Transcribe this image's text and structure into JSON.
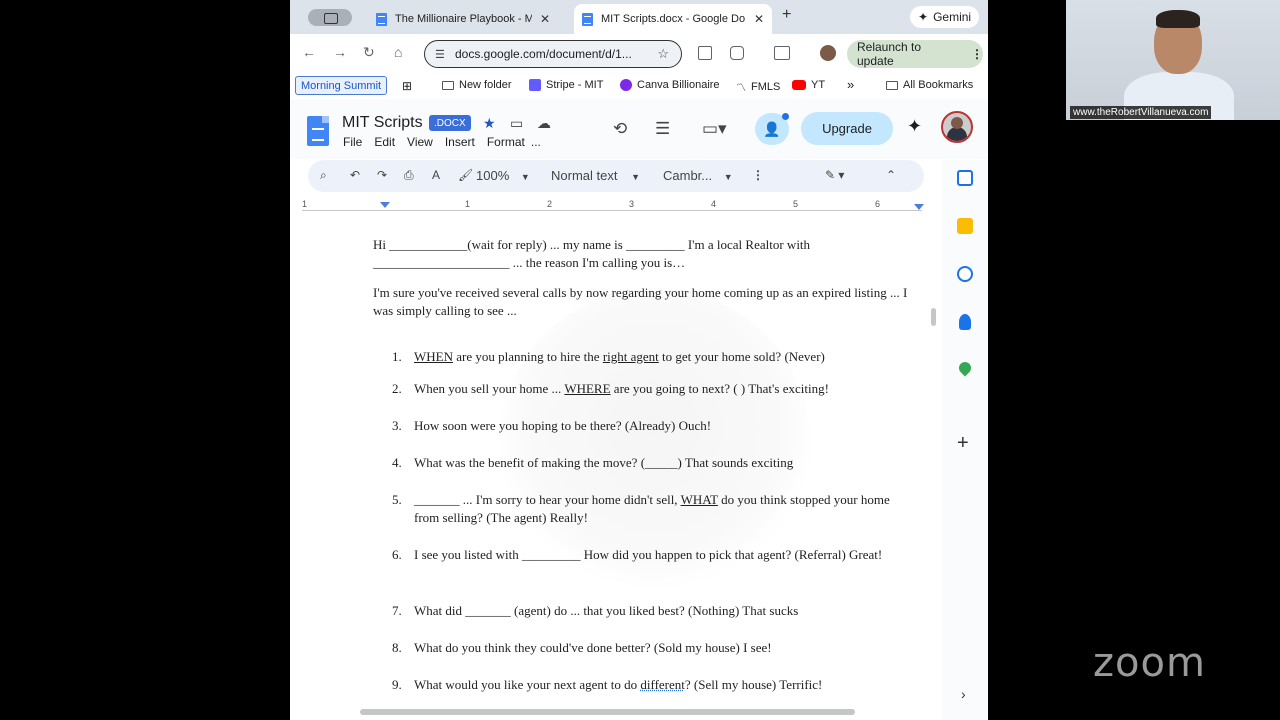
{
  "browser": {
    "tabs": [
      {
        "title": "The Millionaire Playbook - Ma",
        "active": false
      },
      {
        "title": "MIT Scripts.docx - Google Do",
        "active": true
      }
    ],
    "gemini_label": "Gemini",
    "url": "docs.google.com/document/d/1...",
    "relaunch_label": "Relaunch to update",
    "bookmarks": {
      "pinned": "Morning Summit",
      "items": [
        "New folder",
        "Stripe - MIT",
        "Canva Billionaire",
        "FMLS",
        "YT"
      ],
      "overflow": "»",
      "all": "All Bookmarks"
    }
  },
  "doc": {
    "title": "MIT Scripts",
    "badge": ".DOCX",
    "menu": [
      "File",
      "Edit",
      "View",
      "Insert",
      "Format",
      "..."
    ],
    "upgrade_label": "Upgrade",
    "toolbar": {
      "zoom": "100%",
      "style": "Normal text",
      "font": "Cambr..."
    },
    "ruler_numbers": [
      "1",
      "1",
      "2",
      "3",
      "4",
      "5",
      "6"
    ],
    "intro1": "Hi ____________(wait for reply) ... my name is _________ I'm a local Realtor with _____________________ ... the reason I'm calling you is…",
    "intro2": "I'm sure you've received several calls by now regarding your home coming up as an expired listing ... I was simply calling to see ...",
    "items": [
      {
        "num": "1.",
        "pre": "",
        "u1": "WHEN",
        "mid": " are you planning to hire the ",
        "u2": "right agent",
        "post": " to get your home sold? (Never)"
      },
      {
        "num": "2.",
        "pre": "When you sell your home ... ",
        "u1": "WHERE",
        "mid": " are you going to next? (     ) That's exciting!",
        "u2": "",
        "post": ""
      },
      {
        "num": "3.",
        "pre": "How soon were you hoping to be there? (Already) Ouch!",
        "u1": "",
        "mid": "",
        "u2": "",
        "post": ""
      },
      {
        "num": "4.",
        "pre": "What was the benefit of making the move? (_____) That sounds exciting",
        "u1": "",
        "mid": "",
        "u2": "",
        "post": ""
      },
      {
        "num": "5.",
        "pre": "_______ ... I'm sorry to hear your home didn't sell, ",
        "u1": "WHAT",
        "mid": " do you think stopped your home from selling? (The agent) Really!",
        "u2": "",
        "post": ""
      },
      {
        "num": "6.",
        "pre": "I see you listed with _________ How did you happen to pick that agent? (Referral) Great!",
        "u1": "",
        "mid": "",
        "u2": "",
        "post": ""
      },
      {
        "num": "7.",
        "pre": "What did  _______ (agent) do ... that you liked best? (Nothing) That sucks",
        "u1": "",
        "mid": "",
        "u2": "",
        "post": ""
      },
      {
        "num": "8.",
        "pre": "What do you think they could've done better? (Sold my house) I see!",
        "u1": "",
        "mid": "",
        "u2": "",
        "post": ""
      },
      {
        "num": "9.",
        "pre": "What would you like your next agent to do ",
        "u1": "different",
        "mid": "? (Sell my house) Terrific!",
        "u2": "",
        "post": ""
      }
    ]
  },
  "webcam": {
    "label": "www.theRobertVillanueva.com"
  },
  "zoom": {
    "logo": "zoom"
  },
  "icons": [
    "video-call-toggle-icon",
    "docs-icon",
    "close-icon",
    "plus-icon",
    "sparkle-icon",
    "back-icon",
    "forward-icon",
    "reload-icon",
    "home-icon",
    "tune-icon",
    "star-icon",
    "history-icon",
    "comment-icon",
    "video-icon",
    "share-icon",
    "search-icon",
    "undo-icon",
    "redo-icon",
    "print-icon",
    "spellcheck-icon",
    "paint-format-icon",
    "more-icon",
    "edit-pencil-icon",
    "chevron-up-icon",
    "calendar-icon",
    "keep-icon",
    "tasks-icon",
    "contacts-icon",
    "maps-icon",
    "chevron-right-icon"
  ]
}
